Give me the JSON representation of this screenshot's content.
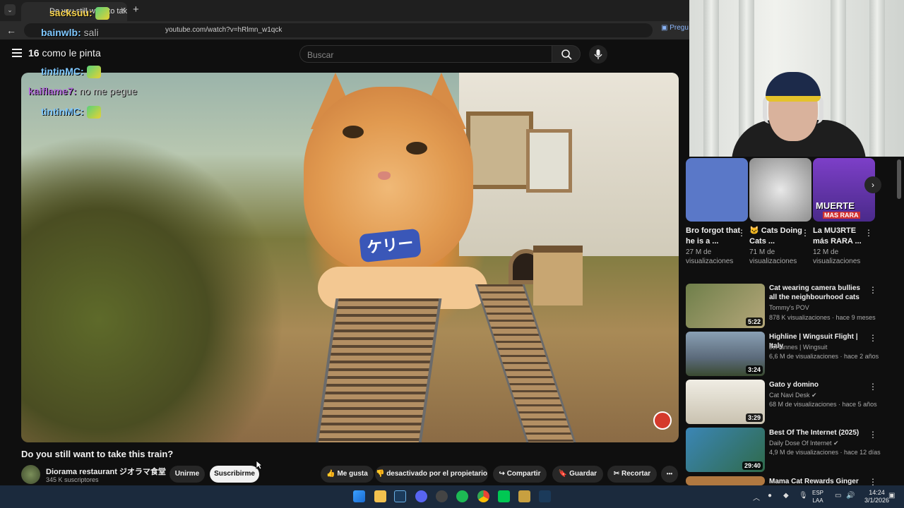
{
  "browser": {
    "tab_title": "Do you still want to take...",
    "url": "youtube.com/watch?v=hRlmn_w1qck",
    "ask_label": "Pregu",
    "new_tab": "+",
    "back": "←"
  },
  "youtube": {
    "search_placeholder": "Buscar",
    "video_title": "Do you still want to take this train?",
    "channel_name": "Diorama restaurant ジオラマ食堂",
    "subscribers": "345 K suscriptores",
    "join_label": "Unirme",
    "subscribe_label": "Suscribirme",
    "like_label": "Me gusta",
    "dislike_label": "desactivado por el propietario",
    "share_label": "Compartir",
    "save_label": "Guardar",
    "clip_label": "Recortar",
    "more_label": "•••",
    "video_tag": "ケリー"
  },
  "chat": [
    {
      "user": "sacksuu:",
      "text": ""
    },
    {
      "user": "bainwlb:",
      "text": "sali"
    },
    {
      "user": "16",
      "text": "como le pinta"
    },
    {
      "user": "tintinMC:",
      "text": ""
    },
    {
      "user": "kaiflame7:",
      "text": "no me pegue"
    },
    {
      "user": "tintinMC:",
      "text": ""
    }
  ],
  "shorts": [
    {
      "title": "Bro forgot that he is a ...",
      "views": "27 M de visualizaciones",
      "color": "#5a78c8"
    },
    {
      "title": "🐱 Cats Doing Cats ...",
      "views": "71 M de visualizaciones",
      "color": "#8e8e8e"
    },
    {
      "title": "La MU3RTE más RARA ...",
      "views": "12 M de visualizaciones",
      "color": "#7d3fc8",
      "overlay1": "MUERTE",
      "overlay2": "MAS RARA"
    }
  ],
  "recommendations": [
    {
      "title": "Cat wearing camera bullies all the neighbourhood cats",
      "channel": "Tommy's POV",
      "meta": "878 K visualizaciones · hace 9 meses",
      "duration": "5:22",
      "color": "#6f7f4a"
    },
    {
      "title": "Highline | Wingsuit Flight | Italy",
      "channel": "JoHannes | Wingsuit",
      "meta": "6,6 M de visualizaciones · hace 2 años",
      "duration": "3:24",
      "color": "#5b6a7a"
    },
    {
      "title": "Gato y domino",
      "channel": "Cat Navi Desk ✔",
      "meta": "68 M de visualizaciones · hace 5 años",
      "duration": "3:29",
      "color": "#c9c2b0"
    },
    {
      "title": "Best Of The Internet (2025)",
      "channel": "Daily Dose Of Internet ✔",
      "meta": "4,9 M de visualizaciones · hace 12 días",
      "duration": "29:40",
      "color": "#3b86b6"
    },
    {
      "title": "Mama Cat Rewards Ginger",
      "channel": "",
      "meta": "",
      "duration": "",
      "color": "#b07840"
    }
  ],
  "taskbar": {
    "lang_line1": "ESP",
    "lang_line2": "LAA",
    "time": "14:24",
    "date": "3/1/2026"
  }
}
